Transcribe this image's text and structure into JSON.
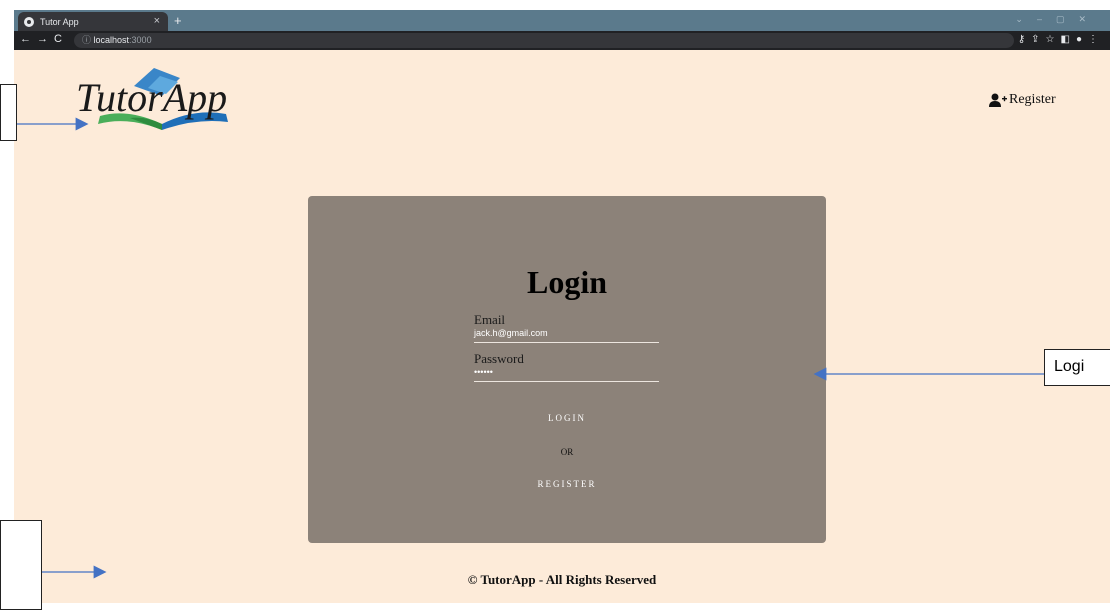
{
  "browser": {
    "tab_title": "Tutor App",
    "tab_close": "×",
    "new_tab": "+",
    "url_host": "localhost",
    "url_port": ":3000",
    "nav_icons": [
      "back-icon",
      "forward-icon",
      "reload-icon"
    ],
    "tool_icons": [
      "key-icon",
      "share-icon",
      "star-icon",
      "sidepanel-icon",
      "profile-icon",
      "menu-icon"
    ]
  },
  "header": {
    "logo_text": "TutorApp",
    "register_label": "Register"
  },
  "login": {
    "title": "Login",
    "email_label": "Email",
    "email_value": "jack.h@gmail.com",
    "password_label": "Password",
    "password_value": "••••••",
    "login_button": "LOGIN",
    "or_text": "OR",
    "register_button": "REGISTER"
  },
  "footer": {
    "text": "© TutorApp - All Rights Reserved"
  },
  "annotations": {
    "right_label": "Logi"
  },
  "colors": {
    "page_bg": "#fdebd9",
    "card_bg": "#8c8279",
    "tabbar": "#5b7a8c",
    "arrow": "#4472c4"
  }
}
